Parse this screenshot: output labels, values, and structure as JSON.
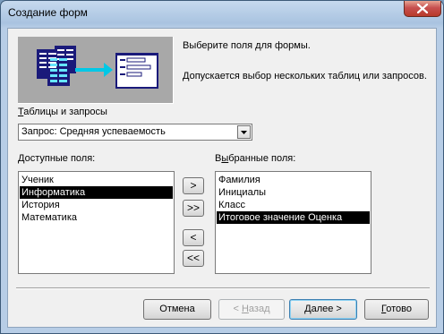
{
  "window": {
    "title": "Создание форм"
  },
  "intro": {
    "line1": "Выберите поля для формы.",
    "line2": "Допускается выбор нескольких таблиц или запросов."
  },
  "source": {
    "label_underline": "Т",
    "label_rest": "аблицы и запросы",
    "value": "Запрос: Средняя успеваемость"
  },
  "available": {
    "label_underline": "Д",
    "label_rest": "оступные поля:",
    "items": [
      "Ученик",
      "Информатика",
      "История",
      "Математика"
    ],
    "selected_index": 1
  },
  "selected": {
    "label_rest_before": "В",
    "label_underline": "ы",
    "label_rest": "бранные поля:",
    "items": [
      "Фамилия",
      "Инициалы",
      "Класс",
      "Итоговое значение Оценка"
    ],
    "selected_index": 3
  },
  "move_buttons": {
    "add_one": ">",
    "add_all": ">>",
    "remove_one": "<",
    "remove_all": "<<"
  },
  "footer": {
    "cancel": "Отмена",
    "back_prefix": "< ",
    "back_underline": "Н",
    "back_rest": "азад",
    "next_underline": "Д",
    "next_rest": "алее >",
    "finish_underline": "Г",
    "finish_rest": "отово"
  },
  "colors": {
    "selection_bg": "#000000",
    "selection_fg": "#ffffff",
    "illustration_bg": "#a8a8a8"
  }
}
